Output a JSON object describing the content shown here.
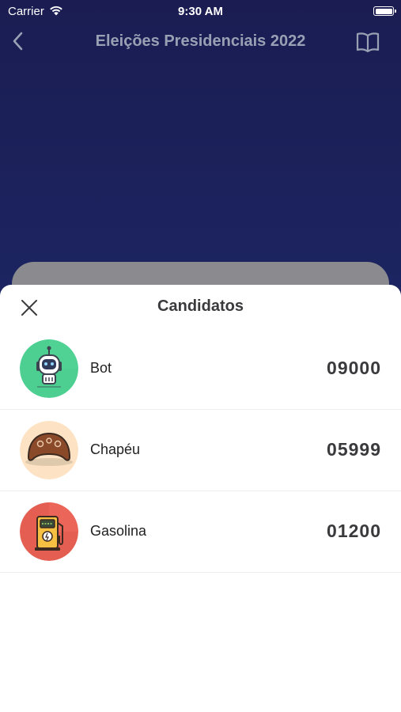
{
  "status_bar": {
    "carrier": "Carrier",
    "time": "9:30 AM"
  },
  "nav": {
    "title": "Eleições Presidenciais 2022",
    "back_icon": "chevron-left-icon",
    "book_icon": "book-icon"
  },
  "sheet": {
    "title": "Candidatos",
    "close_icon": "close-icon",
    "candidates": [
      {
        "name": "Bot",
        "number": "09000",
        "avatar": "robot-avatar",
        "avatar_color": "#4ccf91"
      },
      {
        "name": "Chapéu",
        "number": "05999",
        "avatar": "hat-avatar",
        "avatar_color": "#fde3c4"
      },
      {
        "name": "Gasolina",
        "number": "01200",
        "avatar": "gas-pump-avatar",
        "avatar_color": "#e55e52"
      }
    ]
  },
  "colors": {
    "background_top": "#1b1d52",
    "background_bottom": "#1c3e73",
    "nav_title": "#9aa0b4",
    "behind_card": "#8a8a8f"
  }
}
